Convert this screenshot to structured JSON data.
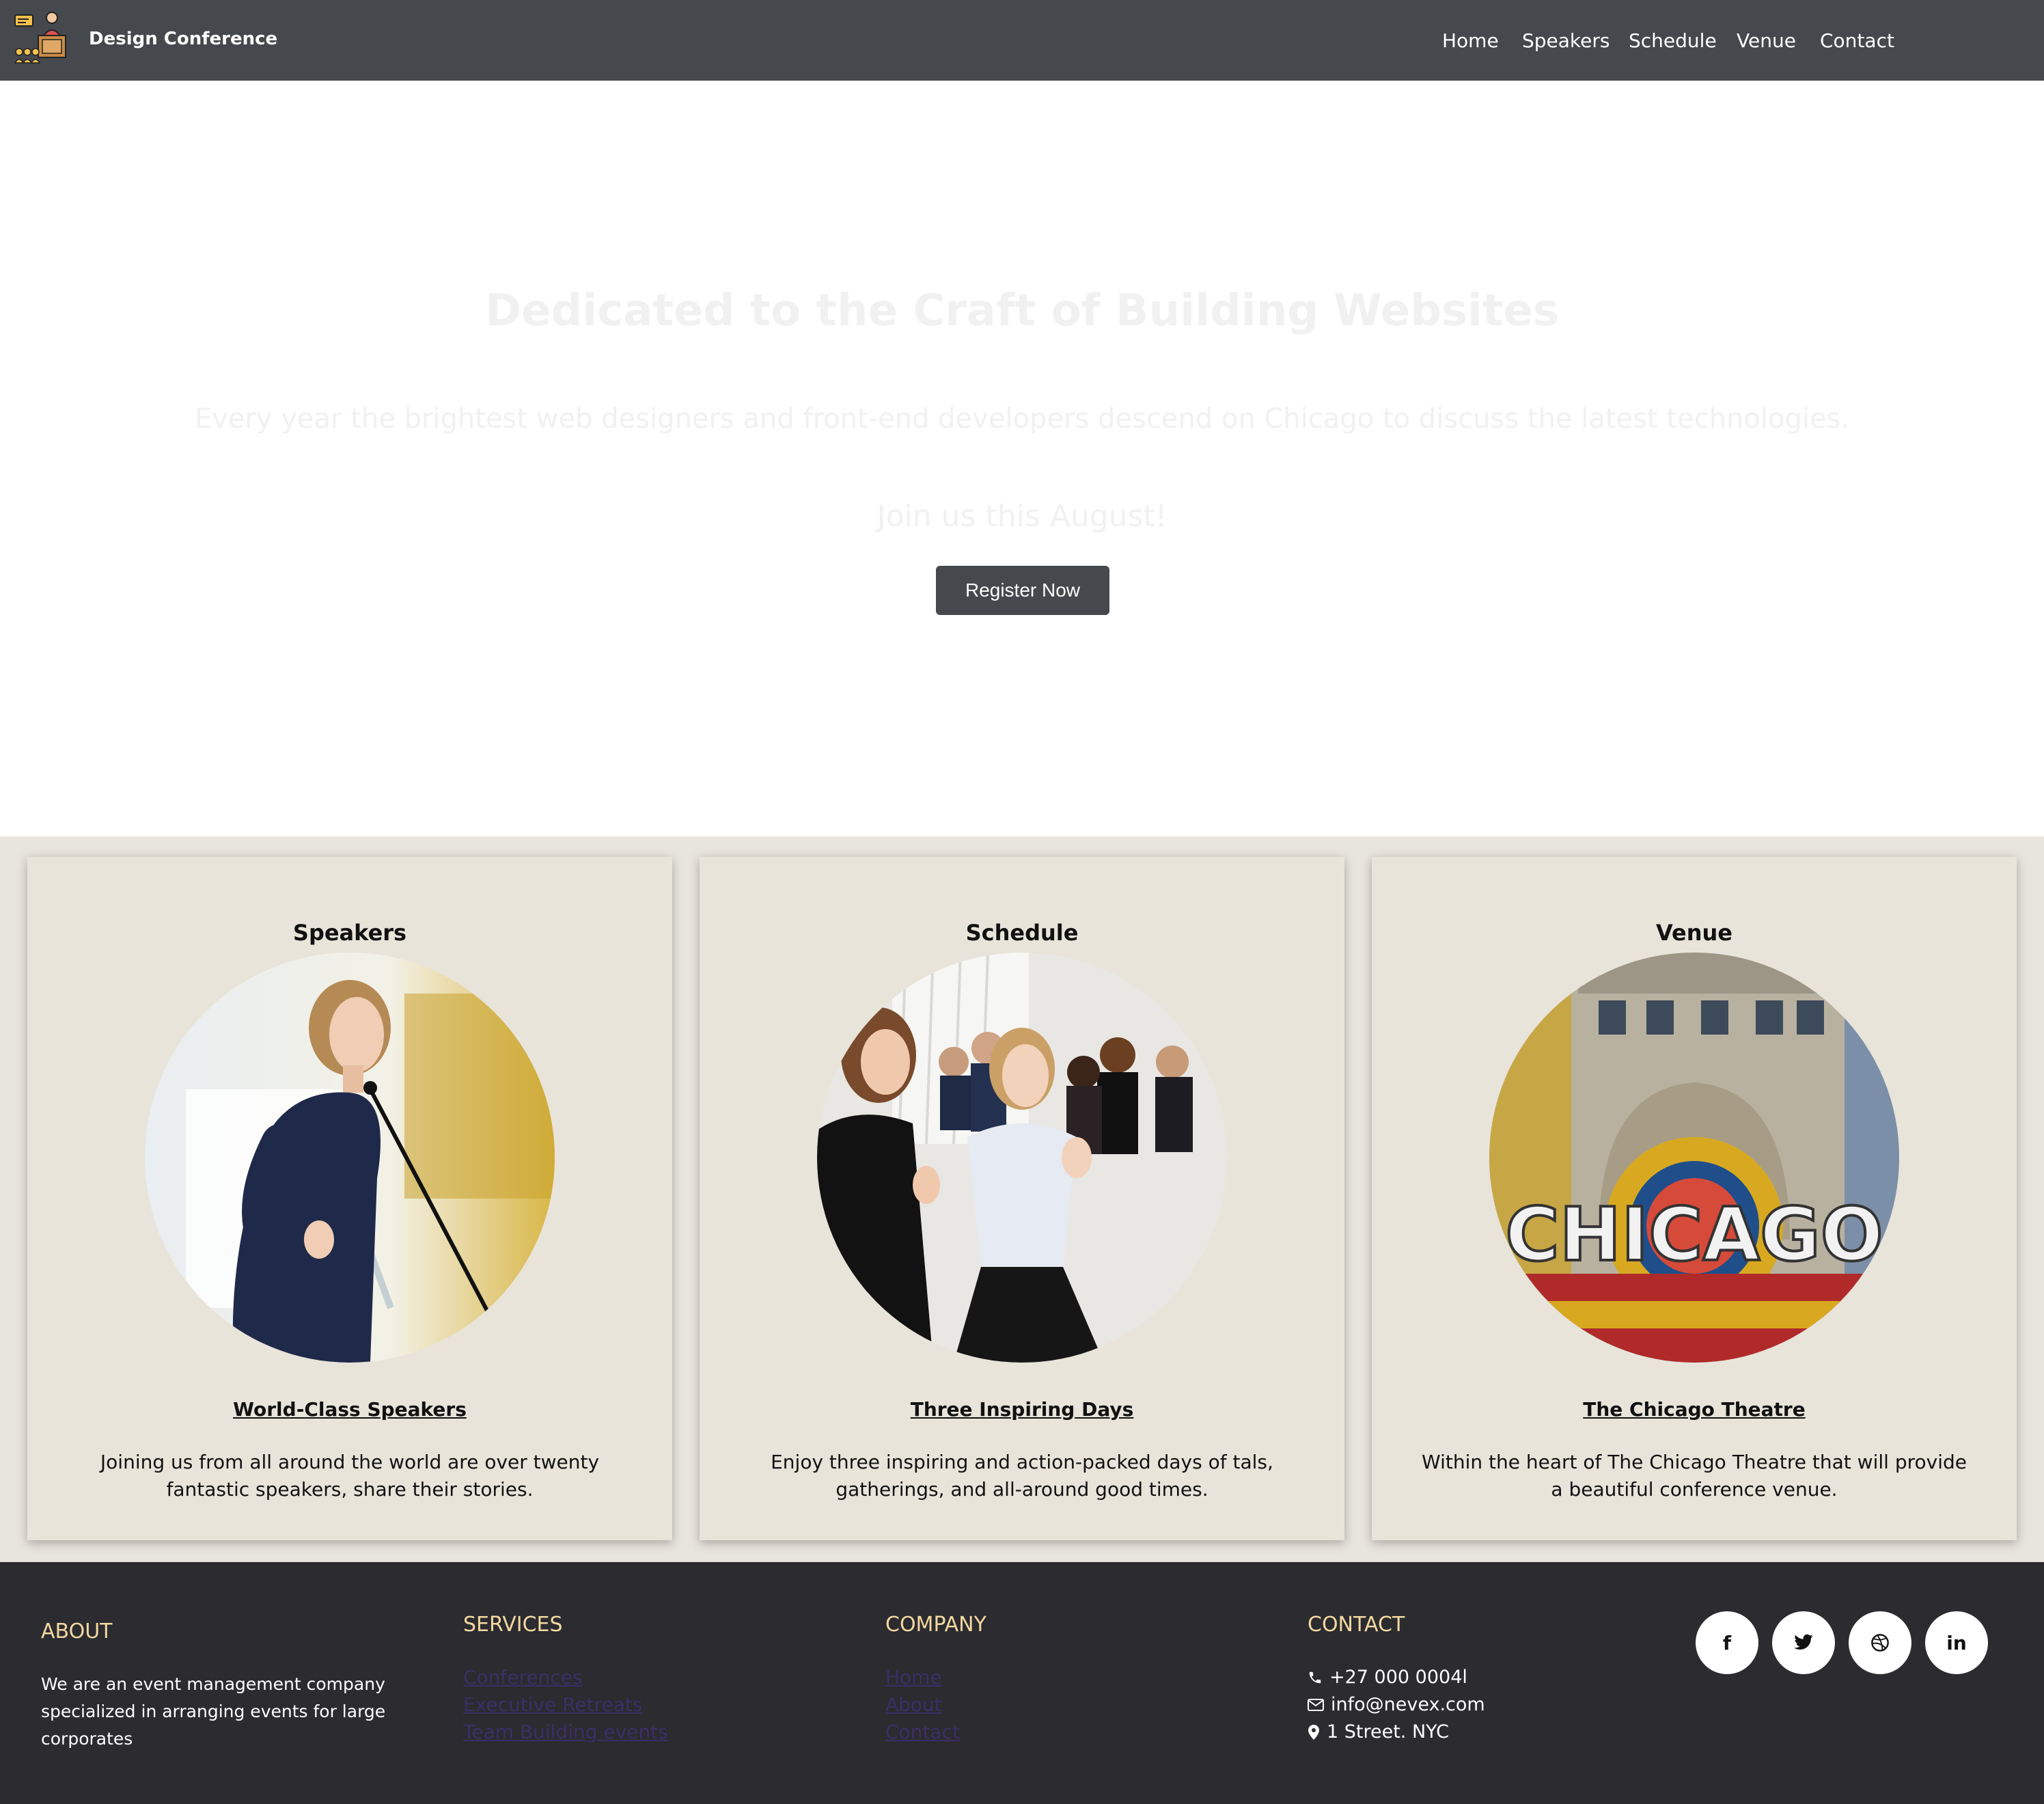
{
  "navbar": {
    "brand_name": "Design Conference",
    "links": [
      "Home",
      "Speakers",
      "Schedule",
      "Venue",
      "Contact"
    ]
  },
  "hero": {
    "title": "Dedicated to the Craft of Building Websites",
    "subtitle": "Every year the brightest web designers and front-end developers descend on Chicago to discuss the latest technologies.",
    "join_text": "Join us this August!",
    "register_label": "Register Now"
  },
  "cards": [
    {
      "title": "Speakers",
      "link": "World-Class Speakers",
      "text": "Joining us from all around the world are over twenty fantastic speakers, share their stories."
    },
    {
      "title": "Schedule",
      "link": "Three Inspiring Days",
      "text": "Enjoy three inspiring and action-packed days of tals, gatherings, and all-around good times."
    },
    {
      "title": "Venue",
      "link": "The Chicago Theatre",
      "text": "Within the heart of The Chicago Theatre that will provide a beautiful conference venue.",
      "sign_text": "CHICAGO"
    }
  ],
  "footer": {
    "about": {
      "heading": "ABOUT",
      "text": "We are an event management company specialized in arranging events for large corporates"
    },
    "services": {
      "heading": "SERVICES",
      "links": [
        "Conferences",
        "Executive Retreats",
        "Team Building events"
      ]
    },
    "company": {
      "heading": "COMPANY",
      "links": [
        "Home",
        "About",
        "Contact"
      ]
    },
    "contact": {
      "heading": "CONTACT",
      "phone": "+27 000 0004l",
      "email": "info@nevex.com",
      "address": "1 Street. NYC"
    },
    "socials": [
      "facebook-icon",
      "twitter-icon",
      "dribbble-icon",
      "linkedin-icon"
    ]
  }
}
